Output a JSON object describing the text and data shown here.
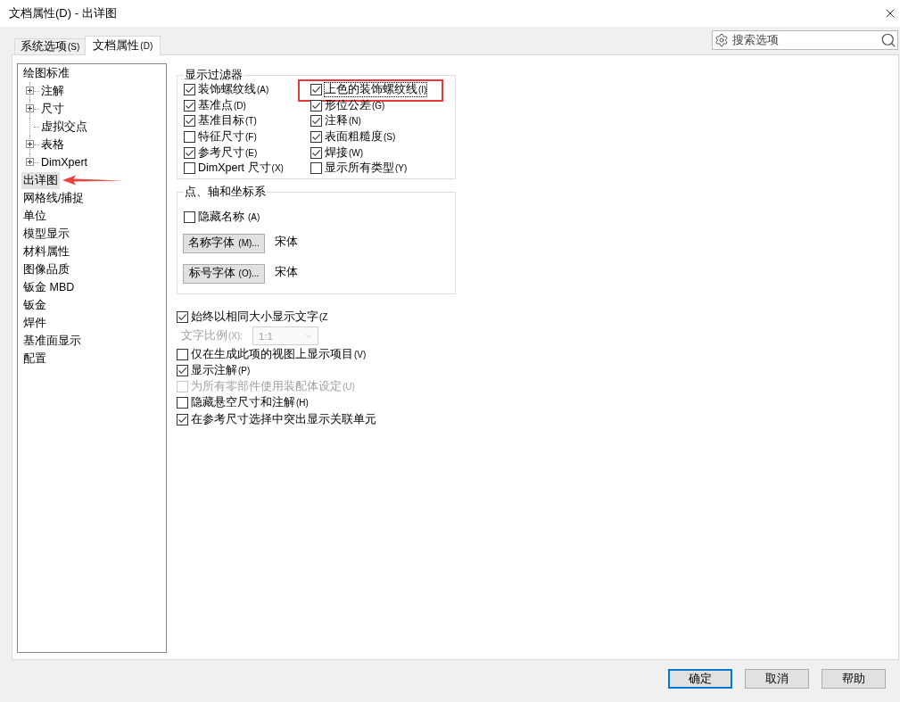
{
  "window": {
    "title": "文档属性(D) - 出详图"
  },
  "tabs": [
    {
      "label": "系统选项",
      "accel": "(S)",
      "selected": false
    },
    {
      "label": "文档属性",
      "accel": "(D)",
      "selected": true
    }
  ],
  "search": {
    "placeholder": "搜索选项"
  },
  "tree": [
    {
      "label": "绘图标准",
      "selected": false,
      "arrow": false,
      "children": [
        {
          "label": "注解",
          "expandable": true,
          "expanded": false,
          "selected": false
        },
        {
          "label": "尺寸",
          "expandable": true,
          "expanded": false,
          "selected": false
        },
        {
          "label": "虚拟交点",
          "expandable": false,
          "selected": false
        },
        {
          "label": "表格",
          "expandable": true,
          "expanded": false,
          "selected": false
        },
        {
          "label": "DimXpert",
          "expandable": true,
          "expanded": false,
          "selected": false
        }
      ]
    },
    {
      "label": "出详图",
      "selected": true,
      "arrow": true
    },
    {
      "label": "网格线/捕捉",
      "selected": false,
      "arrow": false
    },
    {
      "label": "单位",
      "selected": false,
      "arrow": false
    },
    {
      "label": "模型显示",
      "selected": false,
      "arrow": false
    },
    {
      "label": "材料属性",
      "selected": false,
      "arrow": false
    },
    {
      "label": "图像品质",
      "selected": false,
      "arrow": false
    },
    {
      "label": "钣金 MBD",
      "selected": false,
      "arrow": false
    },
    {
      "label": "钣金",
      "selected": false,
      "arrow": false
    },
    {
      "label": "焊件",
      "selected": false,
      "arrow": false
    },
    {
      "label": "基准面显示",
      "selected": false,
      "arrow": false
    },
    {
      "label": "配置",
      "selected": false,
      "arrow": false
    }
  ],
  "display_filter": {
    "title": "显示过滤器",
    "columns": [
      {
        "items": [
          {
            "label": "装饰螺纹线",
            "accel": "(A)",
            "checked": true,
            "highlighted": false,
            "focused": false
          },
          {
            "label": "基准点",
            "accel": "(D)",
            "checked": true,
            "highlighted": false,
            "focused": false
          },
          {
            "label": "基准目标",
            "accel": "(T)",
            "checked": true,
            "highlighted": false,
            "focused": false
          },
          {
            "label": "特征尺寸",
            "accel": "(F)",
            "checked": false,
            "highlighted": false,
            "focused": false
          },
          {
            "label": "参考尺寸",
            "accel": "(E)",
            "checked": true,
            "highlighted": false,
            "focused": false
          },
          {
            "label": "DimXpert 尺寸",
            "accel": "(X)",
            "checked": false,
            "highlighted": false,
            "focused": false
          }
        ]
      },
      {
        "items": [
          {
            "label": "上色的装饰螺纹线",
            "accel": "(I)",
            "checked": true,
            "highlighted": true,
            "focused": true
          },
          {
            "label": "形位公差",
            "accel": "(G)",
            "checked": true,
            "highlighted": false,
            "focused": false
          },
          {
            "label": "注释",
            "accel": "(N)",
            "checked": true,
            "highlighted": false,
            "focused": false
          },
          {
            "label": "表面粗糙度",
            "accel": "(S)",
            "checked": true,
            "highlighted": false,
            "focused": false
          },
          {
            "label": "焊接",
            "accel": "(W)",
            "checked": true,
            "highlighted": false,
            "focused": false
          },
          {
            "label": "显示所有类型",
            "accel": "(Y)",
            "checked": false,
            "highlighted": false,
            "focused": false
          }
        ]
      }
    ]
  },
  "points_axes": {
    "title": "点、轴和坐标系",
    "hide_names": {
      "label": "隐藏名称",
      "accel": "(A)",
      "checked": false
    },
    "fonts": [
      {
        "label": "名称字体",
        "accel": "(M)...",
        "value": "宋体"
      },
      {
        "label": "标号字体",
        "accel": "(O)...",
        "value": "宋体"
      }
    ]
  },
  "options": [
    {
      "kind": "checkbox",
      "label": "始终以相同大小显示文字",
      "accel": "(Z",
      "checked": true,
      "disabled": false
    },
    {
      "kind": "select",
      "label": "文字比例",
      "accel": "(X):",
      "value": "1:1",
      "disabled": true
    },
    {
      "kind": "checkbox",
      "label": "仅在生成此项的视图上显示项目",
      "accel": "(V)",
      "checked": false,
      "disabled": false
    },
    {
      "kind": "checkbox",
      "label": "显示注解",
      "accel": "(P)",
      "checked": true,
      "disabled": false
    },
    {
      "kind": "checkbox",
      "label": "为所有零部件使用装配体设定",
      "accel": "(U)",
      "checked": false,
      "disabled": true
    },
    {
      "kind": "checkbox",
      "label": "隐藏悬空尺寸和注解",
      "accel": "(H)",
      "checked": false,
      "disabled": false
    },
    {
      "kind": "checkbox",
      "label": "在参考尺寸选择中突出显示关联单元",
      "checked": true,
      "disabled": false
    }
  ],
  "buttons": [
    {
      "label": "确定",
      "default": true
    },
    {
      "label": "取消",
      "default": false
    },
    {
      "label": "帮助",
      "default": false
    }
  ]
}
